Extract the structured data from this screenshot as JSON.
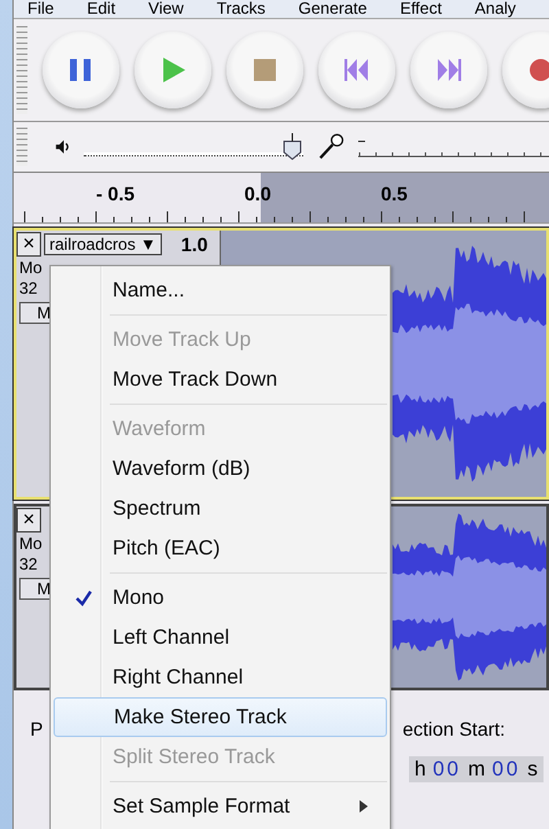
{
  "menu_bar": [
    "File",
    "Edit",
    "View",
    "Tracks",
    "Generate",
    "Effect",
    "Analy"
  ],
  "transport": [
    {
      "kind": "pause"
    },
    {
      "kind": "play"
    },
    {
      "kind": "stop"
    },
    {
      "kind": "skip-start"
    },
    {
      "kind": "skip-end"
    },
    {
      "kind": "record"
    }
  ],
  "meter": {
    "level": 0.95
  },
  "ruler": {
    "labels": [
      "- 0.5",
      "0.0",
      "0.5"
    ]
  },
  "tracks": [
    {
      "close": "×",
      "name": "railroadcros",
      "dropdown": "▼",
      "gain": "1.0",
      "info_1": "Mo",
      "info_2": "32",
      "button": "M",
      "focused": true
    },
    {
      "close": "×",
      "info_1": "Mo",
      "info_2": "32",
      "button": "M",
      "focused": false
    }
  ],
  "context_menu": {
    "items": [
      {
        "kind": "item",
        "label": "Name...",
        "disabled": false,
        "checked": false,
        "selected": false
      },
      {
        "kind": "separator"
      },
      {
        "kind": "item",
        "label": "Move Track Up",
        "disabled": true,
        "checked": false,
        "selected": false
      },
      {
        "kind": "item",
        "label": "Move Track Down",
        "disabled": false,
        "checked": false,
        "selected": false
      },
      {
        "kind": "separator"
      },
      {
        "kind": "item",
        "label": "Waveform",
        "disabled": true,
        "checked": false,
        "selected": false
      },
      {
        "kind": "item",
        "label": "Waveform (dB)",
        "disabled": false,
        "checked": false,
        "selected": false
      },
      {
        "kind": "item",
        "label": "Spectrum",
        "disabled": false,
        "checked": false,
        "selected": false
      },
      {
        "kind": "item",
        "label": "Pitch (EAC)",
        "disabled": false,
        "checked": false,
        "selected": false
      },
      {
        "kind": "separator"
      },
      {
        "kind": "item",
        "label": "Mono",
        "disabled": false,
        "checked": true,
        "selected": false
      },
      {
        "kind": "item",
        "label": "Left Channel",
        "disabled": false,
        "checked": false,
        "selected": false
      },
      {
        "kind": "item",
        "label": "Right Channel",
        "disabled": false,
        "checked": false,
        "selected": false
      },
      {
        "kind": "item",
        "label": "Make Stereo Track",
        "disabled": false,
        "checked": false,
        "selected": true
      },
      {
        "kind": "item",
        "label": "Split Stereo Track",
        "disabled": true,
        "checked": false,
        "selected": false
      },
      {
        "kind": "separator"
      },
      {
        "kind": "submenu",
        "label": "Set Sample Format",
        "disabled": false,
        "checked": false,
        "selected": false
      }
    ]
  },
  "selection_bar": {
    "label_1": "P",
    "label_2": "ection Start:",
    "time": [
      {
        "kind": "unit",
        "text": "h"
      },
      {
        "kind": "digits",
        "text": "00"
      },
      {
        "kind": "unit",
        "text": "m"
      },
      {
        "kind": "digits",
        "text": "00"
      },
      {
        "kind": "unit",
        "text": "s"
      }
    ]
  }
}
